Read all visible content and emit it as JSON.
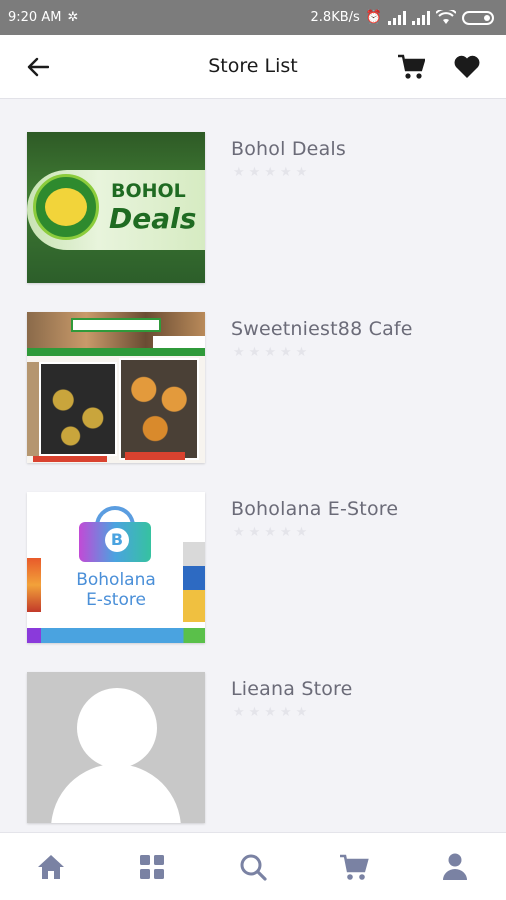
{
  "status_bar": {
    "time": "9:20 AM",
    "network_speed": "2.8KB/s",
    "icons": [
      "alarm-icon",
      "signal-icon",
      "signal-icon",
      "wifi-icon",
      "battery-icon"
    ]
  },
  "header": {
    "title": "Store List",
    "back_icon": "arrow-left-icon",
    "cart_icon": "cart-icon",
    "favorites_icon": "heart-icon"
  },
  "stores": [
    {
      "name": "Bohol Deals",
      "rating": 0,
      "thumbnail": {
        "line1": "BOHOL",
        "line2": "Deals"
      }
    },
    {
      "name": "Sweetniest88 Cafe",
      "rating": 0,
      "thumbnail": {}
    },
    {
      "name": "Boholana E-Store",
      "rating": 0,
      "thumbnail": {
        "badge": "B",
        "line1": "Boholana",
        "line2": "E-store"
      }
    },
    {
      "name": "Lieana Store",
      "rating": 0,
      "thumbnail": {}
    }
  ],
  "bottom_nav": {
    "items": [
      "home-icon",
      "grid-icon",
      "search-icon",
      "cart-icon",
      "user-icon"
    ]
  },
  "colors": {
    "icon": "#7a82a3",
    "header_icon": "#1b1b1b",
    "store_name": "#6b6b78",
    "star_empty": "#e4e4ea",
    "background": "#f3f3f7"
  }
}
